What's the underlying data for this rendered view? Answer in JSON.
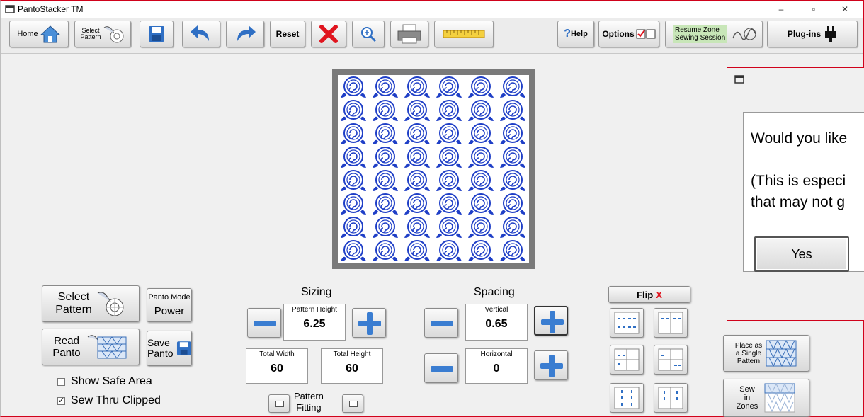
{
  "app": {
    "title": "PantoStacker TM"
  },
  "window_controls": {
    "minimize": "–",
    "maximize": "▫",
    "close": "✕"
  },
  "toolbar": {
    "home": "Home",
    "select_pattern_line1": "Select",
    "select_pattern_line2": "Pattern",
    "reset": "Reset",
    "help": "Help",
    "help_q": "?",
    "options": "Options",
    "resume_line1": "Resume Zone",
    "resume_line2": "Sewing Session",
    "plugins": "Plug-ins"
  },
  "left_panel": {
    "select_pattern_line1": "Select",
    "select_pattern_line2": "Pattern",
    "panto_mode_label": "Panto Mode",
    "panto_mode_value": "Power",
    "read_panto_line1": "Read",
    "read_panto_line2": "Panto",
    "save_panto_line1": "Save",
    "save_panto_line2": "Panto",
    "show_safe_area": {
      "label": "Show Safe Area",
      "checked": false
    },
    "sew_thru_clipped": {
      "label": "Sew Thru Clipped",
      "checked": true
    }
  },
  "sizing": {
    "title": "Sizing",
    "pattern_height_label": "Pattern Height",
    "pattern_height": "6.25",
    "total_width_label": "Total Width",
    "total_width": "60",
    "total_height_label": "Total Height",
    "total_height": "60",
    "pattern_fitting_line1": "Pattern",
    "pattern_fitting_line2": "Fitting"
  },
  "spacing": {
    "title": "Spacing",
    "vertical_label": "Vertical",
    "vertical": "0.65",
    "horizontal_label": "Horizontal",
    "horizontal": "0"
  },
  "flip": {
    "label": "Flip",
    "x": "X"
  },
  "placement": {
    "single_line1": "Place as",
    "single_line2": "a Single",
    "single_line3": "Pattern",
    "zones_line1": "Sew",
    "zones_line2": "in",
    "zones_line3": "Zones"
  },
  "dialog": {
    "line1": "Would you like",
    "line2": "(This is especi",
    "line3": "that may not g",
    "yes": "Yes"
  },
  "colors": {
    "accent": "#3a7dd1",
    "pattern": "#1f3fc7",
    "close_red": "#e0141e",
    "dialog_border": "#d0021b"
  }
}
